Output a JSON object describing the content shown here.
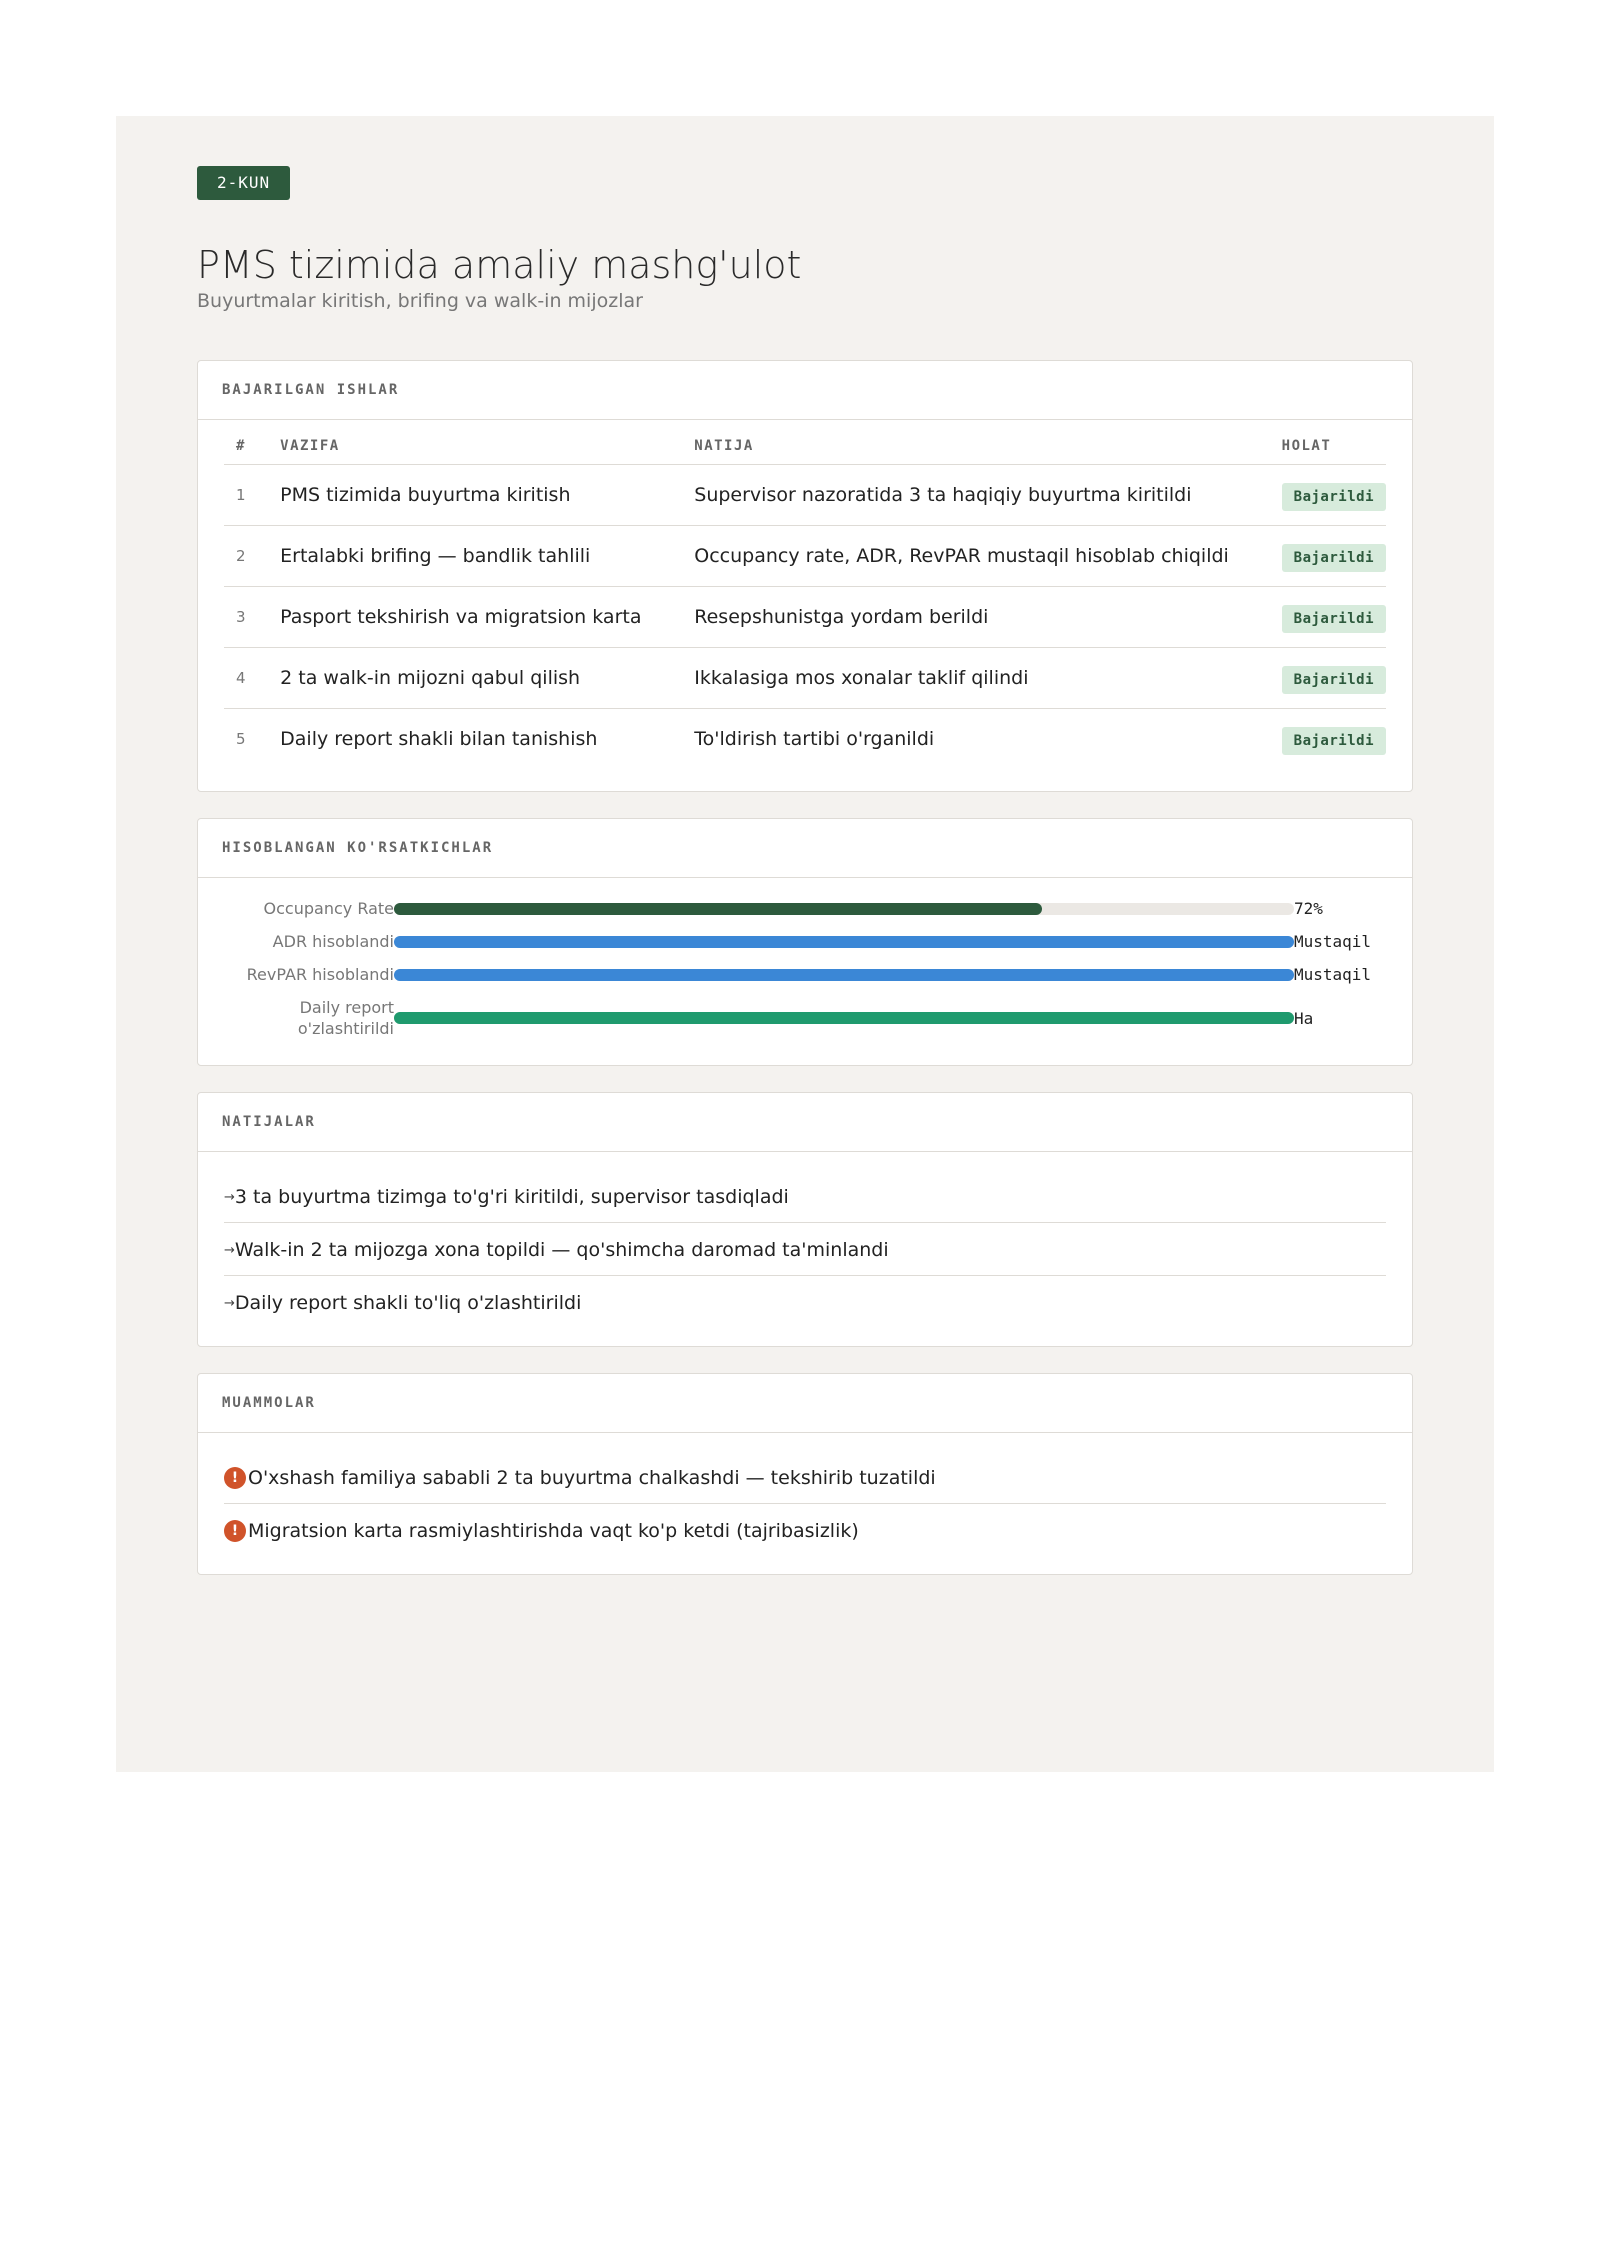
{
  "header": {
    "day_badge": "2-KUN",
    "title": "PMS tizimida amaliy mashg'ulot",
    "subtitle": "Buyurtmalar kiritish, brifing va walk-in mijozlar"
  },
  "tasks": {
    "section_title": "BAJARILGAN ISHLAR",
    "columns": [
      "#",
      "VAZIFA",
      "NATIJA",
      "HOLAT"
    ],
    "rows": [
      {
        "num": "1",
        "task": "PMS tizimida buyurtma kiritish",
        "result": "Supervisor nazoratida 3 ta haqiqiy buyurtma kiritildi",
        "status": "Bajarildi"
      },
      {
        "num": "2",
        "task": "Ertalabki brifing — bandlik tahlili",
        "result": "Occupancy rate, ADR, RevPAR mustaqil hisoblab chiqildi",
        "status": "Bajarildi"
      },
      {
        "num": "3",
        "task": "Pasport tekshirish va migratsion karta",
        "result": "Resepshunistga yordam berildi",
        "status": "Bajarildi"
      },
      {
        "num": "4",
        "task": "2 ta walk-in mijozni qabul qilish",
        "result": "Ikkalasiga mos xonalar taklif qilindi",
        "status": "Bajarildi"
      },
      {
        "num": "5",
        "task": "Daily report shakli bilan tanishish",
        "result": "To'ldirish tartibi o'rganildi",
        "status": "Bajarildi"
      }
    ]
  },
  "metrics": {
    "section_title": "HISOBLANGAN KO'RSATKICHLAR",
    "items": [
      {
        "label": "Occupancy Rate",
        "value": "72%",
        "fill": 0.72,
        "color": "#2d5a3d"
      },
      {
        "label": "ADR hisoblandi",
        "value": "Mustaqil",
        "fill": 1.0,
        "color": "#3b87d6"
      },
      {
        "label": "RevPAR hisoblandi",
        "value": "Mustaqil",
        "fill": 1.0,
        "color": "#3b87d6"
      },
      {
        "label": "Daily report o'zlashtirildi",
        "value": "Ha",
        "fill": 1.0,
        "color": "#1f9a6e"
      }
    ]
  },
  "results": {
    "section_title": "NATIJALAR",
    "arrow_symbol": "→",
    "items": [
      "3 ta buyurtma tizimga to'g'ri kiritildi, supervisor tasdiqladi",
      "Walk-in 2 ta mijozga xona topildi — qo'shimcha daromad ta'minlandi",
      "Daily report shakli to'liq o'zlashtirildi"
    ]
  },
  "problems": {
    "section_title": "MUAMMOLAR",
    "warning_symbol": "!",
    "items": [
      "O'xshash familiya sababli 2 ta buyurtma chalkashdi — tekshirib tuzatildi",
      "Migratsion karta rasmiylashtirishda vaqt ko'p ketdi (tajribasizlik)"
    ]
  }
}
